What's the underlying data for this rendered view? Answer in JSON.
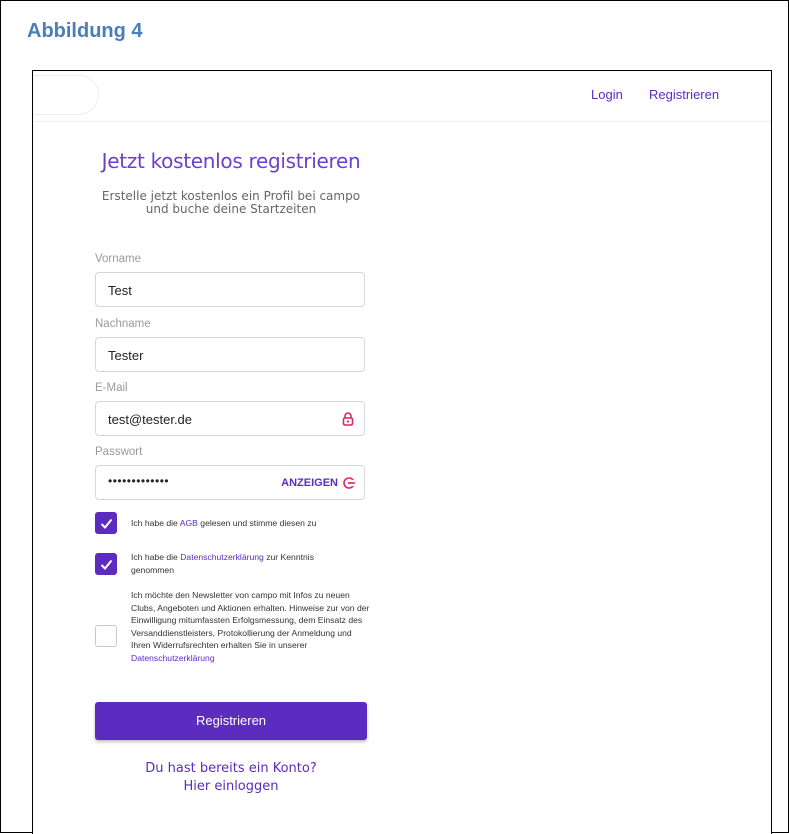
{
  "figure": {
    "title": "Abbildung 4"
  },
  "nav": {
    "login": "Login",
    "register": "Registrieren"
  },
  "form": {
    "heading": "Jetzt kostenlos registrieren",
    "subheading_line1": "Erstelle jetzt kostenlos ein Profil bei campo",
    "subheading_line2": "und buche deine Startzeiten",
    "fields": [
      {
        "label": "Vorname",
        "value": "Test"
      },
      {
        "label": "Nachname",
        "value": "Tester"
      },
      {
        "label": "E-Mail",
        "value": "test@tester.de"
      },
      {
        "label": "Passwort",
        "value": "•••••••••••••",
        "show_label": "ANZEIGEN"
      }
    ],
    "checkboxes": [
      {
        "checked": true,
        "text_before": "Ich habe die ",
        "link": "AGB",
        "text_after": " gelesen und stimme diesen zu"
      },
      {
        "checked": true,
        "text_before": "Ich habe die ",
        "link": "Datenschutzerklärung",
        "text_after": " zur Kenntnis genommen"
      },
      {
        "checked": false,
        "text_before": "Ich möchte den Newsletter von campo mit Infos zu neuen Clubs, Angeboten und Aktionen erhalten. Hinweise zur von der Einwilligung mitumfassten Erfolgsmessung, dem Einsatz des Versanddienstleisters, Protokollierung der Anmeldung und Ihren Widerrufsrechten erhalten Sie in unserer ",
        "link": "Datenschutzerklärung",
        "text_after": ""
      }
    ],
    "submit_label": "Registrieren",
    "has_account": "Du hast bereits ein Konto?",
    "login_here": "Hier einloggen"
  },
  "colors": {
    "accent": "#5c2bbf",
    "heading": "#6e40c9",
    "figure_title": "#4a7ebb",
    "icon_red": "#e0245e"
  }
}
